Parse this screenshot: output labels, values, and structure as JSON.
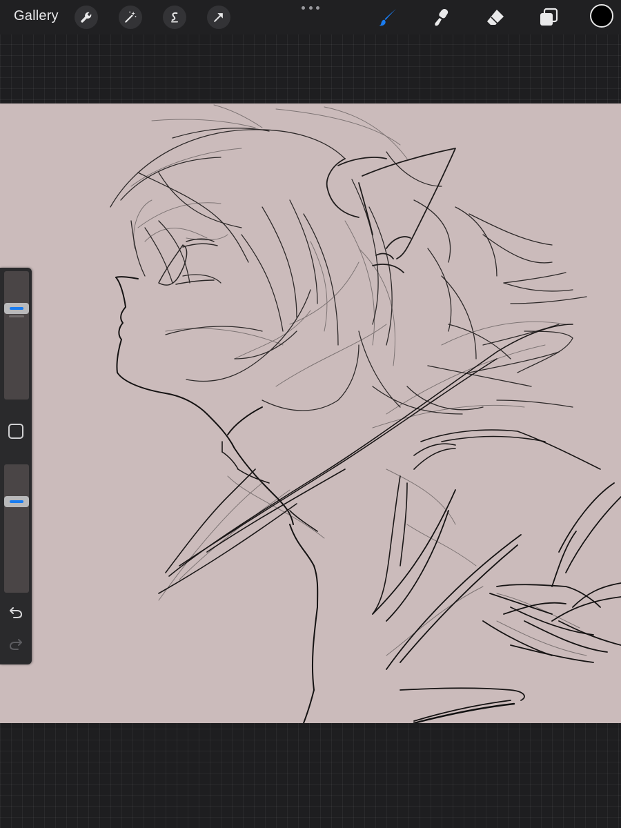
{
  "toolbar": {
    "gallery_label": "Gallery",
    "left_tools": [
      "wrench-icon",
      "magic-wand-icon",
      "selection-s-icon",
      "transform-arrow-icon"
    ],
    "right_tools": [
      "brush-icon",
      "smudge-icon",
      "eraser-icon",
      "layers-icon"
    ],
    "active_tool": "brush-icon",
    "active_color": "#000000"
  },
  "canvas": {
    "background_color": "#cbbbbb"
  },
  "sidebar": {
    "brush_size_level": 0.73,
    "opacity_level": 0.73,
    "undo_icon": "undo-icon",
    "redo_icon": "redo-icon",
    "redo_enabled": false
  },
  "colors": {
    "accent": "#1a7cf0",
    "toolbar_bg": "#202022",
    "workspace_bg": "#1e1e20"
  }
}
